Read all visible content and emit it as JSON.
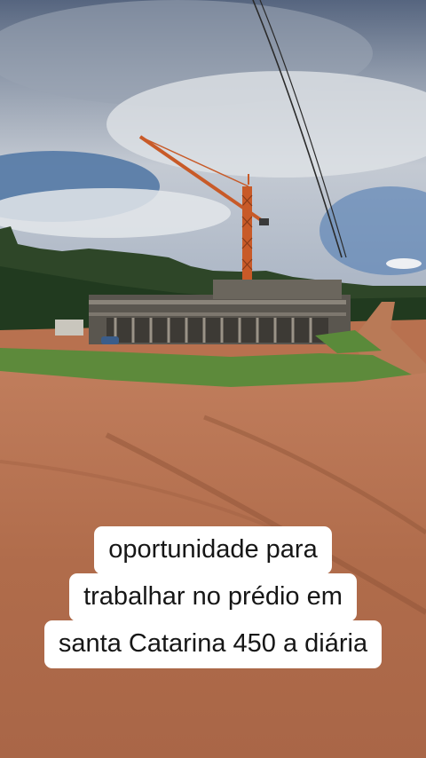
{
  "caption": {
    "lines": [
      "oportunidade para",
      "trabalhar no prédio em",
      "santa Catarina 450 a diária"
    ]
  },
  "colors": {
    "sky_top": "#5d6e8a",
    "sky_blue": "#4f78a8",
    "clouds": "#d7dbe0",
    "trees": "#2f4a2a",
    "grass": "#5f8a3c",
    "dirt": "#b8714f",
    "crane": "#c85a28",
    "caption_bg": "#ffffff",
    "caption_text": "#161616"
  }
}
